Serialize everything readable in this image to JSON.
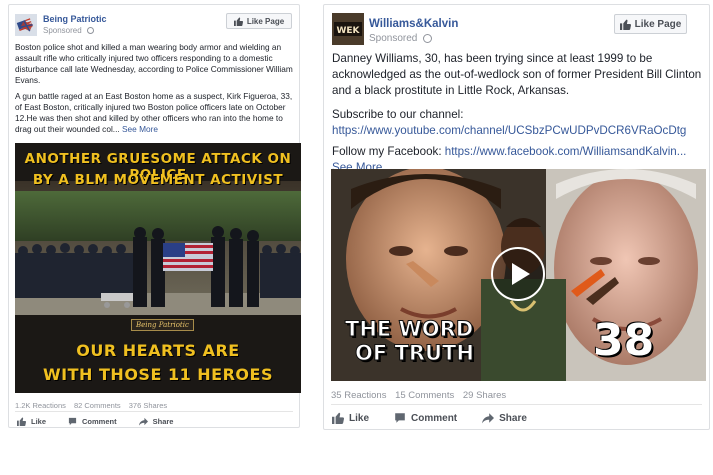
{
  "posts": [
    {
      "page_name": "Being Patriotic",
      "sponsored": "Sponsored",
      "like_page": "Like Page",
      "paragraphs": [
        "Boston police shot and killed a man wearing body armor and wielding an assault rifle who critically injured two officers responding to a domestic disturbance call late Wednesday, according to Police Commissioner William Evans.",
        "A gun battle raged at an East Boston home as a suspect, Kirk Figueroa, 33, of East Boston, critically injured two Boston police officers late on October 12.He was then shot and killed by other officers who ran into the home to drag out their wounded col..."
      ],
      "see_more": "See More",
      "image": {
        "headline_line1": "ANOTHER GRUESOME ATTACK ON POLICE",
        "headline_line2": "BY A BLM MOVEMENT ACTIVIST",
        "tag": "Being Patriotic",
        "footer_line1": "OUR HEARTS ARE",
        "footer_line2": "WITH THOSE 11 HEROES"
      },
      "stats": {
        "reactions": "1.2K Reactions",
        "comments": "82 Comments",
        "shares": "376 Shares"
      },
      "actions": {
        "like": "Like",
        "comment": "Comment",
        "share": "Share"
      }
    },
    {
      "page_name": "Williams&Kalvin",
      "sponsored": "Sponsored",
      "like_page": "Like Page",
      "avatar_text": "WEK",
      "paragraph": "Danney Williams, 30, has been trying since at least 1999 to be acknowledged as the out-of-wedlock son of former President Bill Clinton and a black prostitute in Little Rock, Arkansas.",
      "subscribe_label": "Subscribe to our channel:",
      "subscribe_link": "https://www.youtube.com/channel/UCSbzPCwUDPvDCR6VRaOcDtg",
      "follow_label": "Follow my Facebook: ",
      "follow_link": "https://www.facebook.com/WilliamsandKalvin...",
      "see_more": "See More",
      "image": {
        "title_line1": "THE WORD",
        "title_line2": "OF TRUTH",
        "episode": "38"
      },
      "stats": {
        "reactions": "35 Reactions",
        "comments": "15 Comments",
        "shares": "29 Shares"
      },
      "actions": {
        "like": "Like",
        "comment": "Comment",
        "share": "Share"
      }
    }
  ],
  "colors": {
    "link": "#365899",
    "meta": "#90949c",
    "border": "#dddfe2",
    "banner_gold": "#f0c020"
  },
  "icons": [
    "flag-avatar-icon",
    "globe-icon",
    "thumbs-up-icon",
    "comment-icon",
    "share-icon",
    "play-icon"
  ]
}
